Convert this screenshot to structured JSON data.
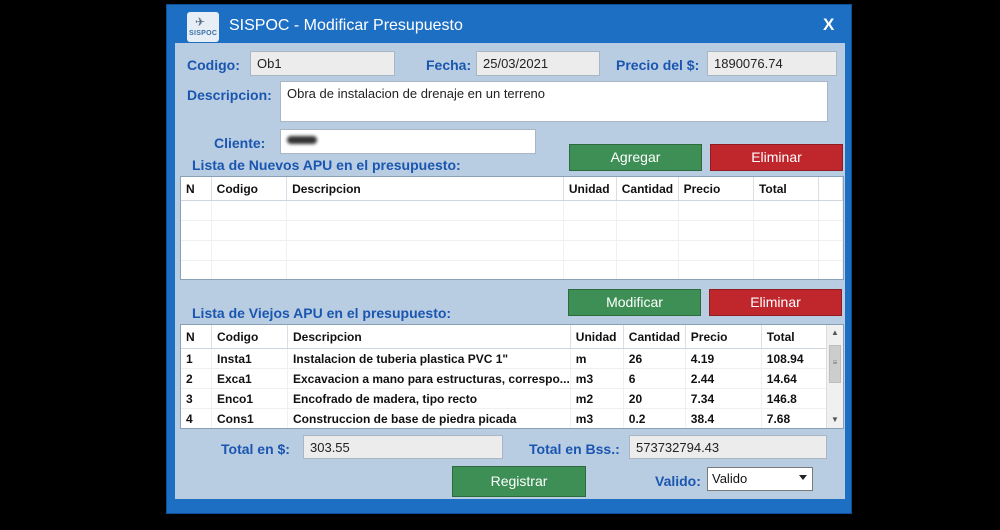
{
  "window": {
    "title": "SISPOC - Modificar Presupuesto",
    "close_label": "X",
    "icon_text": "SISPOC"
  },
  "form": {
    "codigo_label": "Codigo:",
    "codigo_value": "Ob1",
    "fecha_label": "Fecha:",
    "fecha_value": "25/03/2021",
    "precio_label": "Precio del $:",
    "precio_value": "1890076.74",
    "descripcion_label": "Descripcion:",
    "descripcion_value": "Obra de instalacion de drenaje en un terreno",
    "cliente_label": "Cliente:"
  },
  "nuevos": {
    "title": "Lista de Nuevos APU en el presupuesto:",
    "add_label": "Agregar",
    "delete_label": "Eliminar",
    "columns": [
      "N",
      "Codigo",
      "Descripcion",
      "Unidad",
      "Cantidad",
      "Precio",
      "Total"
    ]
  },
  "viejos": {
    "title": "Lista de Viejos APU en el presupuesto:",
    "modify_label": "Modificar",
    "delete_label": "Eliminar",
    "columns": [
      "N",
      "Codigo",
      "Descripcion",
      "Unidad",
      "Cantidad",
      "Precio",
      "Total"
    ],
    "rows": [
      [
        "1",
        "Insta1",
        "Instalacion de tuberia plastica PVC 1\"",
        "m",
        "26",
        "4.19",
        "108.94"
      ],
      [
        "2",
        "Exca1",
        "Excavacion a mano para estructuras, correspo...",
        "m3",
        "6",
        "2.44",
        "14.64"
      ],
      [
        "3",
        "Enco1",
        "Encofrado de madera, tipo recto",
        "m2",
        "20",
        "7.34",
        "146.8"
      ],
      [
        "4",
        "Cons1",
        "Construccion de base de piedra picada",
        "m3",
        "0.2",
        "38.4",
        "7.68"
      ]
    ]
  },
  "totals": {
    "usd_label": "Total en $:",
    "usd_value": "303.55",
    "bss_label": "Total en Bss.:",
    "bss_value": "573732794.43"
  },
  "footer": {
    "register_label": "Registrar",
    "valido_label": "Valido:",
    "valido_value": "Valido"
  }
}
